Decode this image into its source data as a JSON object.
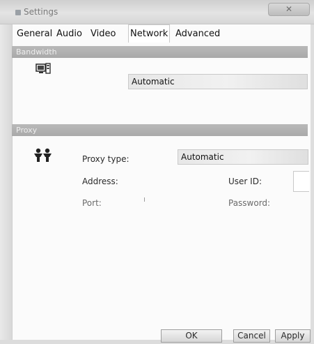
{
  "window": {
    "title": "Settings",
    "close_glyph": "✕"
  },
  "tabs": [
    {
      "label": "General",
      "active": false
    },
    {
      "label": "Audio",
      "active": false
    },
    {
      "label": "Video",
      "active": false
    },
    {
      "label": "Network",
      "active": true
    },
    {
      "label": "Advanced",
      "active": false
    }
  ],
  "bandwidth": {
    "header": "Bandwidth",
    "icon": "network-monitor-icon",
    "mode_value": "Automatic",
    "scale_ticks": [
      "",
      "",
      "",
      "",
      "",
      ""
    ]
  },
  "proxy": {
    "header": "Proxy",
    "icon": "proxy-users-icon",
    "type_label": "Proxy type:",
    "type_value": "Automatic",
    "address_label": "Address:",
    "user_id_label": "User ID:",
    "port_label": "Port:",
    "password_label": "Password:"
  },
  "buttons": {
    "ok": "OK",
    "cancel": "Cancel",
    "apply": "Apply"
  },
  "colors": {
    "section_header": "#aaaaaa",
    "window_bg": "#fbfbfb"
  }
}
